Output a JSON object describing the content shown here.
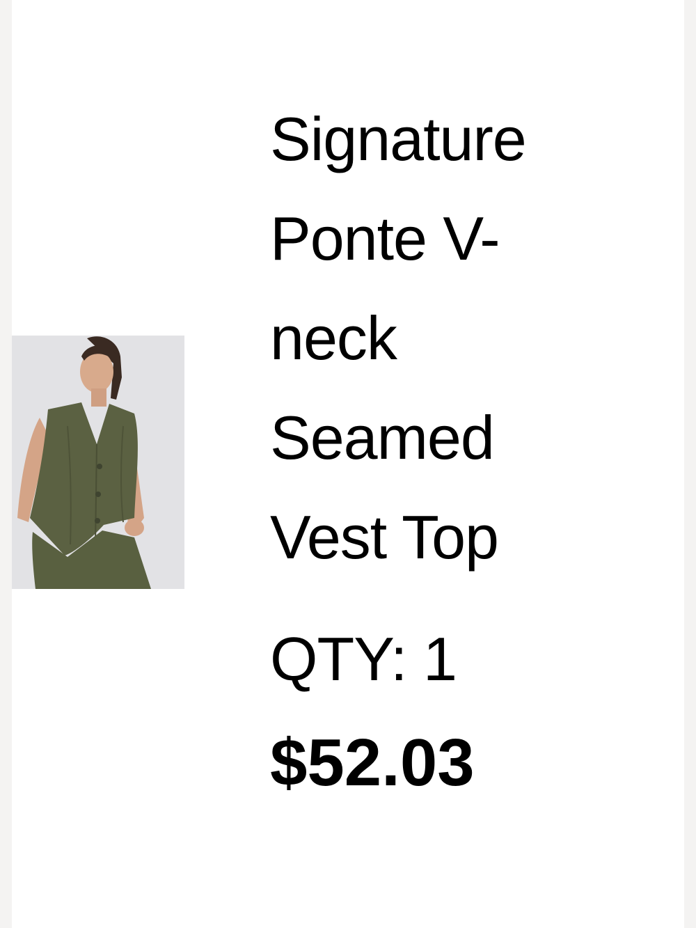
{
  "product": {
    "title_lines": [
      "Signature",
      "Ponte V-",
      "neck",
      "Seamed",
      "Vest Top"
    ],
    "qty_label": "QTY: 1",
    "price": "$52.03",
    "image": "model-wearing-olive-vest",
    "image_color": "#5b6142"
  }
}
